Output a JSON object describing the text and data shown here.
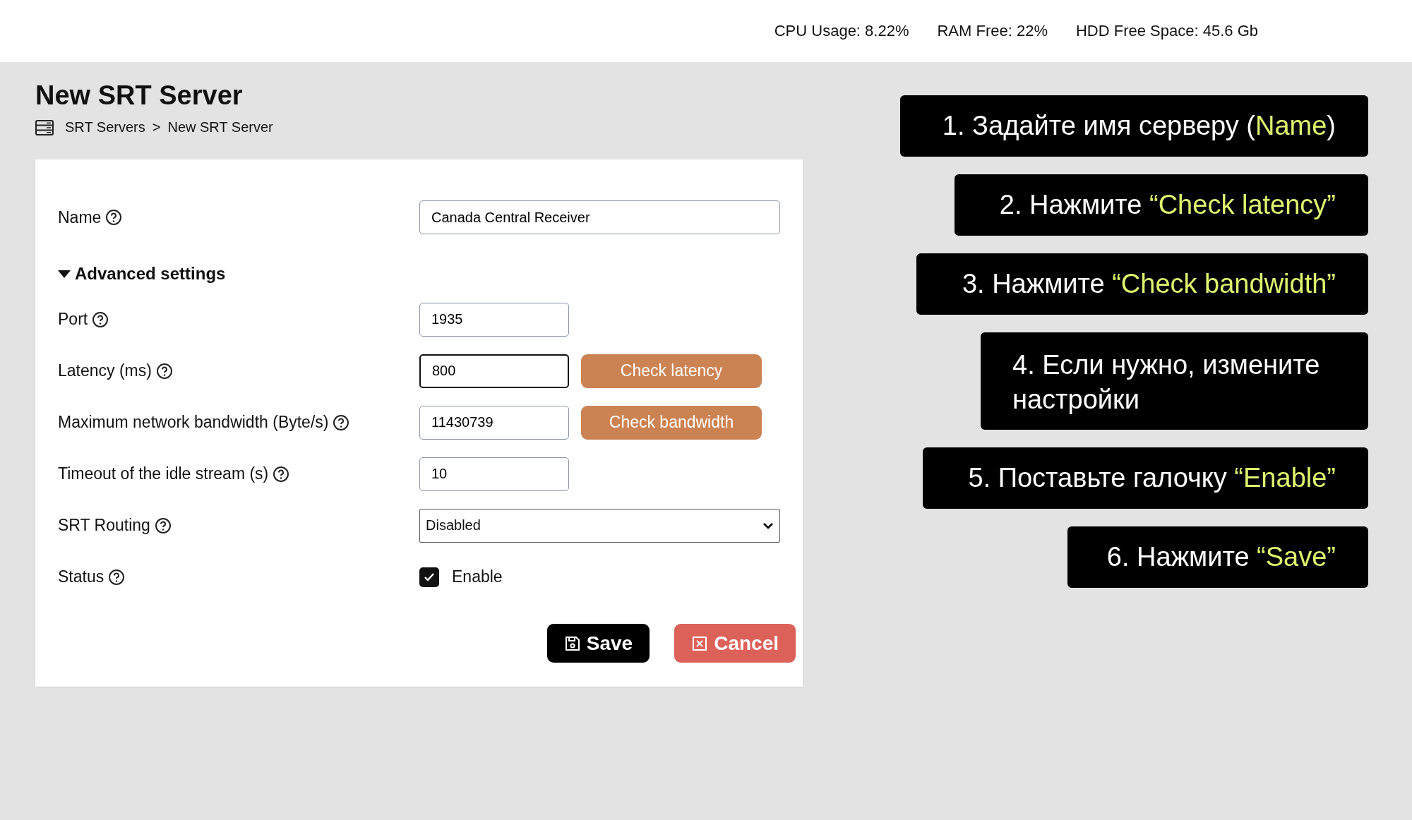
{
  "top_bar": {
    "stats": [
      "CPU Usage: 8.22%",
      "RAM Free: 22%",
      "HDD Free Space: 45.6 Gb"
    ]
  },
  "page": {
    "title": "New SRT Server",
    "breadcrumb": [
      "SRT Servers",
      ">",
      "New SRT Server"
    ]
  },
  "form": {
    "name_row": {
      "label": "Name",
      "value": "Canada Central Receiver"
    },
    "advanced": {
      "label": "Advanced settings",
      "expanded": true
    },
    "rows": [
      {
        "kind": "input",
        "label": "Port",
        "value": "1935",
        "focused": false
      },
      {
        "kind": "input",
        "label": "Latency (ms)",
        "value": "800",
        "focused": true,
        "button": "Check latency"
      },
      {
        "kind": "input",
        "label": "Maximum network bandwidth (Byte/s)",
        "value": "11430739",
        "focused": false,
        "button": "Check bandwidth"
      },
      {
        "kind": "input",
        "label": "Timeout of the idle stream (s)",
        "value": "10",
        "focused": false
      },
      {
        "kind": "select",
        "label": "SRT Routing",
        "value": "Disabled"
      },
      {
        "kind": "checkbox",
        "label": "Status",
        "option": "Enable",
        "checked": true
      }
    ],
    "buttons": {
      "save": "Save",
      "cancel": "Cancel"
    }
  },
  "callouts": [
    {
      "parts": [
        {
          "text": "1. Задайте имя серверу (",
          "highlight": false
        },
        {
          "text": "Name",
          "highlight": true
        },
        {
          "text": ")",
          "highlight": false
        }
      ]
    },
    {
      "parts": [
        {
          "text": "2. Нажмите ",
          "highlight": false
        },
        {
          "text": "“Check latency”",
          "highlight": true
        }
      ]
    },
    {
      "parts": [
        {
          "text": "3. Нажмите ",
          "highlight": false
        },
        {
          "text": "“Check bandwidth”",
          "highlight": true
        }
      ]
    },
    {
      "parts": [
        {
          "text": "4. Если нужно, измените настройки",
          "highlight": false
        }
      ]
    },
    {
      "parts": [
        {
          "text": "5. Поставьте галочку ",
          "highlight": false
        },
        {
          "text": "“Enable”",
          "highlight": true
        }
      ]
    },
    {
      "parts": [
        {
          "text": "6. Нажмите ",
          "highlight": false
        },
        {
          "text": "“Save”",
          "highlight": true
        }
      ]
    }
  ]
}
